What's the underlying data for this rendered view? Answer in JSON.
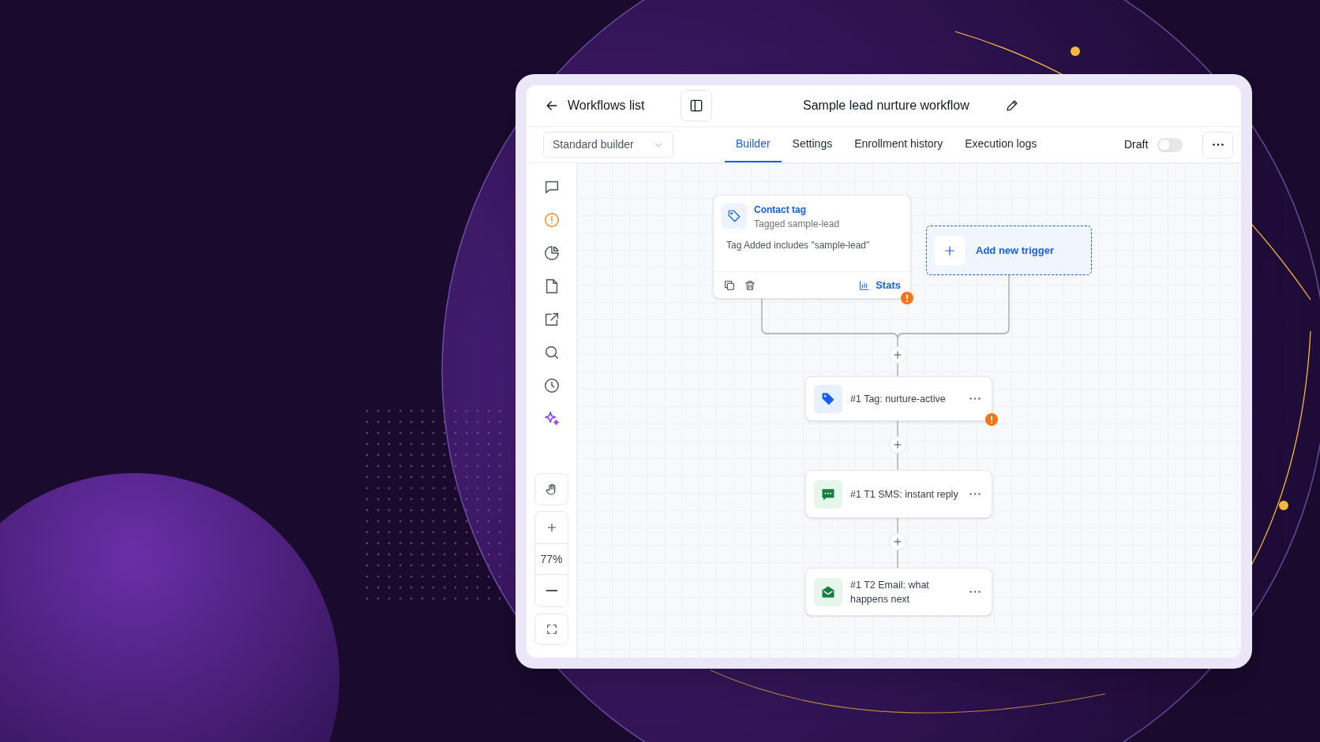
{
  "header": {
    "back_label": "Workflows list",
    "title": "Sample lead nurture workflow"
  },
  "builder_select": {
    "value": "Standard builder"
  },
  "tabs": [
    {
      "label": "Builder",
      "selected": true
    },
    {
      "label": "Settings",
      "selected": false
    },
    {
      "label": "Enrollment history",
      "selected": false
    },
    {
      "label": "Execution logs",
      "selected": false
    }
  ],
  "status": {
    "label": "Draft",
    "on": false
  },
  "zoom": {
    "reading": "77%"
  },
  "trigger": {
    "title": "Contact tag",
    "subtitle": "Tagged sample-lead",
    "condition": "Tag Added includes \"sample-lead\"",
    "stats_label": "Stats",
    "warning": true
  },
  "add_trigger": {
    "label": "Add new trigger"
  },
  "steps": [
    {
      "kind": "tag",
      "label": "#1 Tag: nurture-active",
      "warning": true
    },
    {
      "kind": "sms",
      "label": "#1 T1 SMS: instant reply",
      "warning": false
    },
    {
      "kind": "email",
      "label": "#1 T2 Email: what happens next",
      "warning": false
    }
  ]
}
